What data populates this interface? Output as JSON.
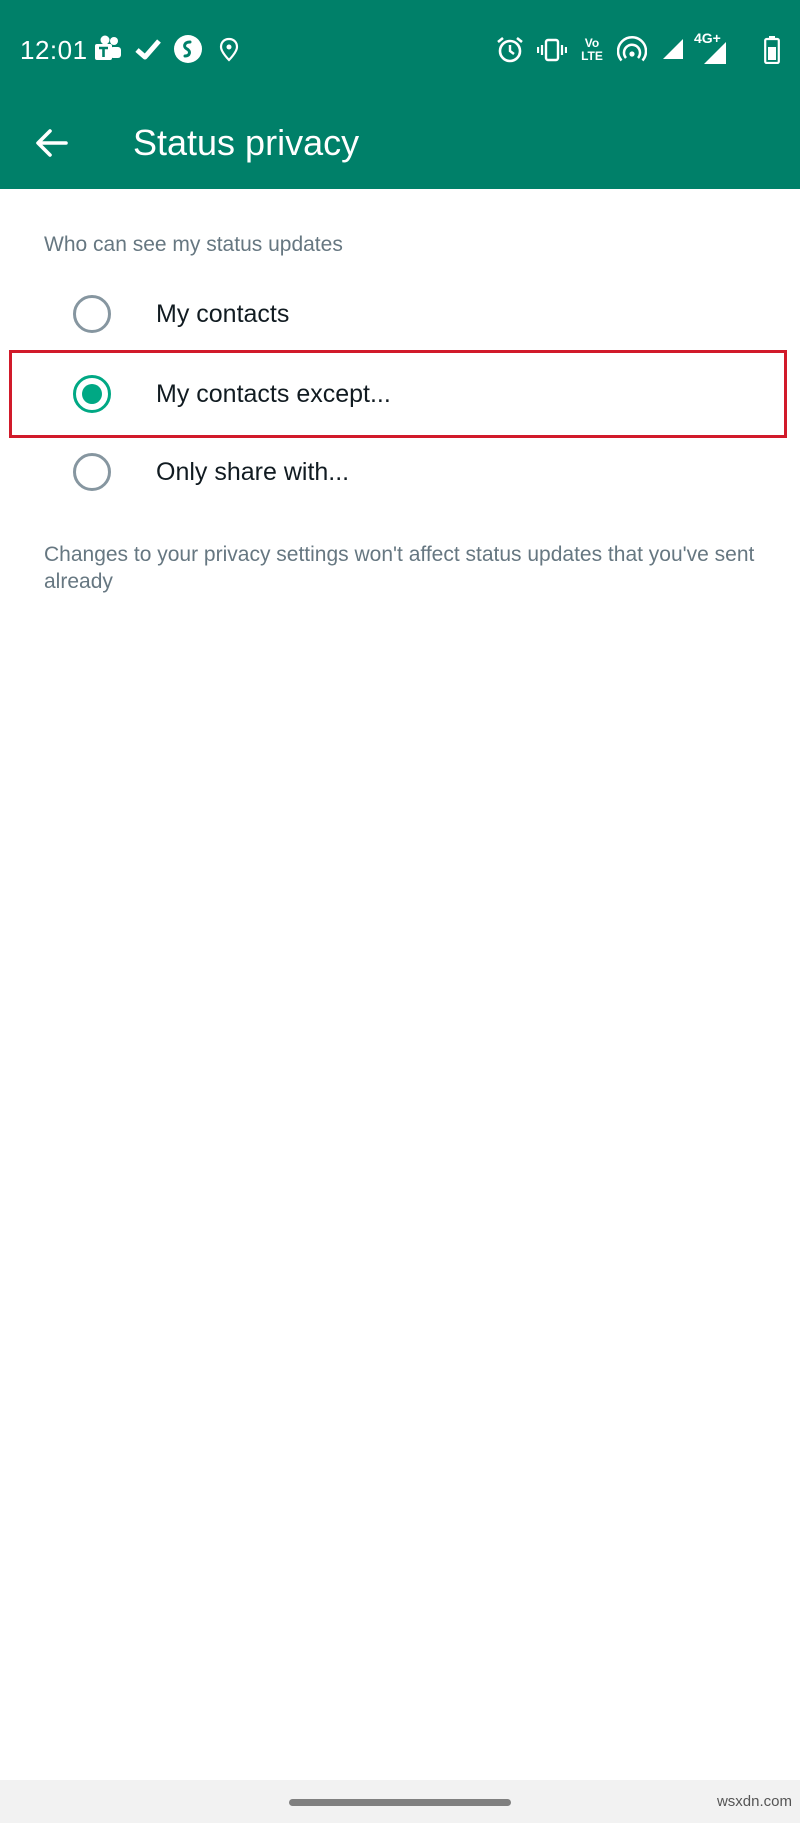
{
  "status_bar": {
    "time": "12:01",
    "left_icons": [
      "teams-icon",
      "check-icon",
      "shazam-icon",
      "location-icon"
    ],
    "right_icons": [
      "alarm-icon",
      "vibrate-icon",
      "volte-icon",
      "hotspot-icon",
      "signal-icon",
      "4g-signal-icon",
      "battery-icon"
    ],
    "volte_label_top": "Vo",
    "volte_label_bottom": "LTE",
    "network_label": "4G+"
  },
  "app_bar": {
    "title": "Status privacy",
    "background": "#008069"
  },
  "content": {
    "section_header": "Who can see my status updates",
    "options": [
      {
        "label": "My contacts",
        "selected": false
      },
      {
        "label": "My contacts except...",
        "selected": true
      },
      {
        "label": "Only share with...",
        "selected": false
      }
    ],
    "footnote": "Changes to your privacy settings won't affect status updates that you've sent already"
  },
  "colors": {
    "accent": "#00a884",
    "highlight": "#d11a2a"
  },
  "watermark": "wsxdn.com"
}
